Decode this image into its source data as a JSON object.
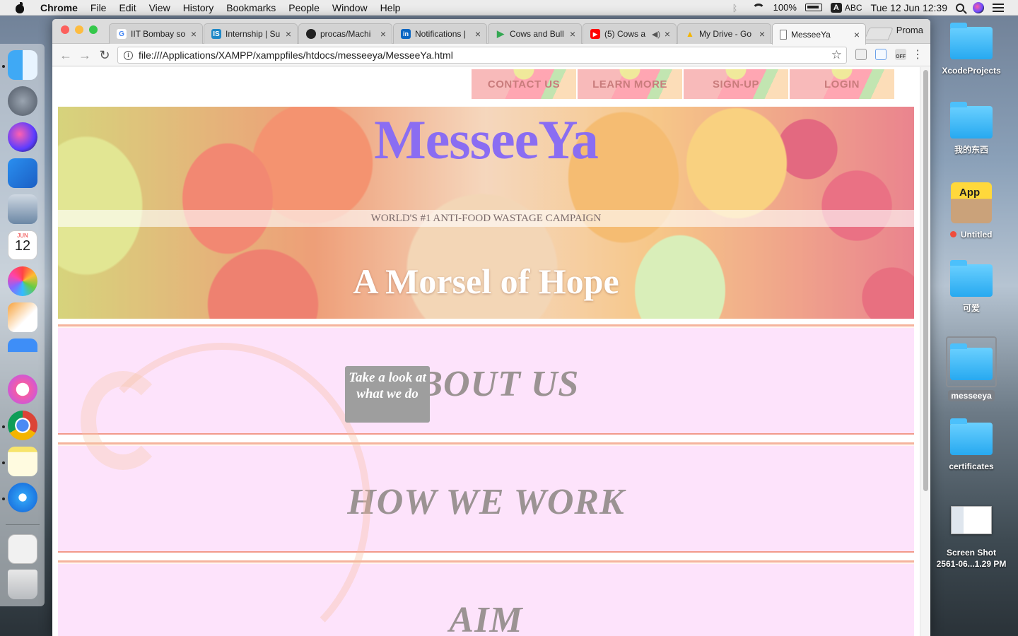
{
  "menubar": {
    "app": "Chrome",
    "items": [
      "File",
      "Edit",
      "View",
      "History",
      "Bookmarks",
      "People",
      "Window",
      "Help"
    ],
    "battery": "100%",
    "input_source": "A",
    "input_label": "ABC",
    "clock": "Tue 12 Jun  12:39"
  },
  "browser": {
    "tabs": [
      {
        "title": "IIT Bombay so",
        "icon": "google-icon",
        "color": "#4285f4",
        "glyph": "G"
      },
      {
        "title": "Internship | Su",
        "icon": "internshala-icon",
        "color": "#1e88c7",
        "glyph": "IS"
      },
      {
        "title": "procas/Machi",
        "icon": "github-icon",
        "color": "#222222",
        "glyph": "●"
      },
      {
        "title": "Notifications |",
        "icon": "linkedin-icon",
        "color": "#0a66c2",
        "glyph": "in"
      },
      {
        "title": "Cows and Bull",
        "icon": "play-store-icon",
        "color": "#34a853",
        "glyph": "▶"
      },
      {
        "title": "(5) Cows a",
        "icon": "youtube-icon",
        "color": "#ff0000",
        "glyph": "▶"
      },
      {
        "title": "My Drive - Go",
        "icon": "drive-icon",
        "color": "#f4b400",
        "glyph": "▲"
      },
      {
        "title": "MesseeYa",
        "icon": "document-icon",
        "color": "#ffffff",
        "glyph": ""
      }
    ],
    "profile": "Proma",
    "url": "file:///Applications/XAMPP/xamppfiles/htdocs/messeeya/MesseeYa.html"
  },
  "page": {
    "nav": [
      "CONTACT US",
      "LEARN MORE",
      "SIGN-UP",
      "LOGIN"
    ],
    "brand": "MesseeYa",
    "brand_color": "#8a6df2",
    "tagline": "WORLD'S #1 ANTI-FOOD WASTAGE CAMPAIGN",
    "hero_title": "A Morsel of Hope",
    "sections": [
      "ABOUT US",
      "HOW WE WORK",
      "AIM"
    ],
    "tooltip": "Take a look at what we do"
  },
  "desktop": {
    "items": [
      {
        "label": "XcodeProjects",
        "icon": "folder-icon"
      },
      {
        "label": "我的东西",
        "icon": "folder-icon"
      },
      {
        "label": "Untitled",
        "icon": "app-store-package-icon"
      },
      {
        "label": "可爱",
        "icon": "folder-icon"
      },
      {
        "label": "messeeya",
        "icon": "folder-alias-icon"
      },
      {
        "label": "certificates",
        "icon": "folder-icon"
      },
      {
        "label": "Screen Shot\n2561-06...1.29 PM",
        "icon": "screenshot-thumbnail-icon"
      }
    ]
  },
  "dock": {
    "apps": [
      "finder-icon",
      "launchpad-icon",
      "siri-icon",
      "xcode-icon",
      "preview-icon",
      "calendar-icon",
      "photos-icon",
      "pages-icon",
      "keynote-icon",
      "itunes-icon",
      "chrome-icon",
      "notes-icon",
      "safari-icon",
      "documents-stack-icon",
      "trash-icon"
    ],
    "calendar_month": "JUN",
    "calendar_day": "12"
  }
}
